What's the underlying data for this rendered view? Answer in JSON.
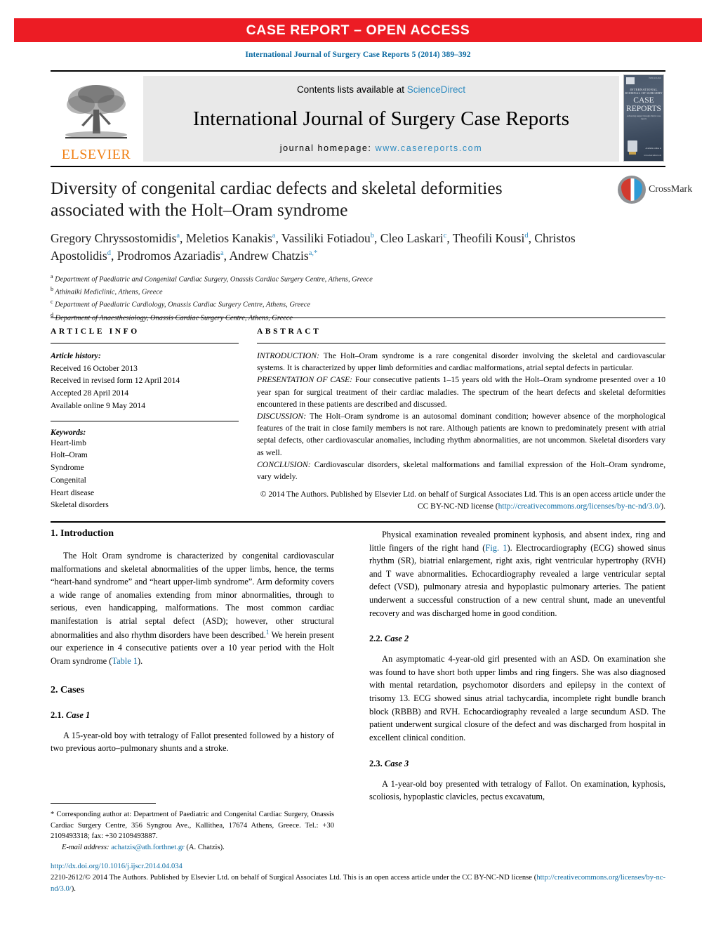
{
  "banner": {
    "text": "CASE REPORT – OPEN ACCESS"
  },
  "citation": {
    "text": "International Journal of Surgery Case Reports 5 (2014) 389–392"
  },
  "masthead": {
    "contents_prefix": "Contents lists available at ",
    "contents_link": "ScienceDirect",
    "journal_title": "International Journal of Surgery Case Reports",
    "homepage_label": "journal homepage: ",
    "homepage_url": "www.casereports.com",
    "publisher": "ELSEVIER",
    "cover": {
      "line1": "INTERNATIONAL",
      "line2": "JOURNAL OF SURGERY",
      "big1": "CASE",
      "big2": "REPORTS",
      "subtitle": "Advancing surgery through clinical case reports",
      "issn": "ISSN 2210-2612",
      "right_text": "Available online at",
      "url": "www.sciencedirect.com"
    }
  },
  "article": {
    "title": "Diversity of congenital cardiac defects and skeletal deformities associated with the Holt–Oram syndrome",
    "authors": [
      {
        "name": "Gregory Chryssostomidis",
        "marks": "a",
        "sep": ", "
      },
      {
        "name": "Meletios Kanakis",
        "marks": "a",
        "sep": ", "
      },
      {
        "name": "Vassiliki Fotiadou",
        "marks": "b",
        "sep": ", "
      },
      {
        "name": "Cleo Laskari",
        "marks": "c",
        "sep": ", "
      },
      {
        "name": "Theofili Kousi",
        "marks": "d",
        "sep": ", "
      },
      {
        "name": "Christos Apostolidis",
        "marks": "d",
        "sep": ", "
      },
      {
        "name": "Prodromos Azariadis",
        "marks": "a",
        "sep": ", "
      },
      {
        "name": "Andrew Chatzis",
        "marks": "a,*",
        "sep": ""
      }
    ],
    "affiliations": [
      {
        "mark": "a",
        "text": "Department of Paediatric and Congenital Cardiac Surgery, Onassis Cardiac Surgery Centre, Athens, Greece"
      },
      {
        "mark": "b",
        "text": "Athinaiki Mediclinic, Athens, Greece"
      },
      {
        "mark": "c",
        "text": "Department of Paediatric Cardiology, Onassis Cardiac Surgery Centre, Athens, Greece"
      },
      {
        "mark": "d",
        "text": "Department of Anaesthesiology, Onassis Cardiac Surgery Centre, Athens, Greece"
      }
    ]
  },
  "crossmark": {
    "label": "CrossMark"
  },
  "article_info": {
    "heading": "ARTICLE INFO",
    "history_label": "Article history:",
    "history": [
      "Received 16 October 2013",
      "Received in revised form 12 April 2014",
      "Accepted 28 April 2014",
      "Available online 9 May 2014"
    ],
    "keywords_label": "Keywords:",
    "keywords": [
      "Heart-limb",
      "Holt–Oram",
      "Syndrome",
      "Congenital",
      "Heart disease",
      "Skeletal disorders"
    ]
  },
  "abstract": {
    "heading": "ABSTRACT",
    "sections": [
      {
        "label": "INTRODUCTION:",
        "text": " The Holt–Oram syndrome is a rare congenital disorder involving the skeletal and cardiovascular systems. It is characterized by upper limb deformities and cardiac malformations, atrial septal defects in particular."
      },
      {
        "label": "PRESENTATION OF CASE:",
        "text": " Four consecutive patients 1–15 years old with the Holt–Oram syndrome presented over a 10 year span for surgical treatment of their cardiac maladies. The spectrum of the heart defects and skeletal deformities encountered in these patients are described and discussed."
      },
      {
        "label": "DISCUSSION:",
        "text": " The Holt–Oram syndrome is an autosomal dominant condition; however absence of the morphological features of the trait in close family members is not rare. Although patients are known to predominately present with atrial septal defects, other cardiovascular anomalies, including rhythm abnormalities, are not uncommon. Skeletal disorders vary as well."
      },
      {
        "label": "CONCLUSION:",
        "text": " Cardiovascular disorders, skeletal malformations and familial expression of the Holt–Oram syndrome, vary widely."
      }
    ],
    "copyright_pre": "© 2014 The Authors. Published by Elsevier Ltd. on behalf of Surgical Associates Ltd. This is an open access article under the CC BY-NC-ND license (",
    "copyright_link": "http://creativecommons.org/licenses/by-nc-nd/3.0/",
    "copyright_post": ")."
  },
  "body": {
    "left": {
      "h_intro": "1. Introduction",
      "p_intro_a": "The Holt Oram syndrome is characterized by congenital cardiovascular malformations and skeletal abnormalities of the upper limbs, hence, the terms “heart-hand syndrome” and “heart upper-limb syndrome”. Arm deformity covers a wide range of anomalies extending from minor abnormalities, through to serious, even handicapping, malformations. The most common cardiac manifestation is atrial septal defect (ASD); however, other structural abnormalities and also rhythm disorders have been described.",
      "p_intro_ref": "1",
      "p_intro_b": " We herein present our experience in 4 consecutive patients over a 10 year period with the Holt Oram syndrome (",
      "p_intro_link": "Table 1",
      "p_intro_c": ").",
      "h_cases": "2. Cases",
      "h_case1_num": "2.1.",
      "h_case1": " Case 1",
      "p_case1": "A 15-year-old boy with tetralogy of Fallot presented followed by a history of two previous aorto–pulmonary shunts and a stroke."
    },
    "right": {
      "p_case1_cont_a": "Physical examination revealed prominent kyphosis, and absent index, ring and little fingers of the right hand (",
      "p_case1_link": "Fig. 1",
      "p_case1_cont_b": "). Electrocardiography (ECG) showed sinus rhythm (SR), biatrial enlargement, right axis, right ventricular hypertrophy (RVH) and T wave abnormalities. Echocardiography revealed a large ventricular septal defect (VSD), pulmonary atresia and hypoplastic pulmonary arteries. The patient underwent a successful construction of a new central shunt, made an uneventful recovery and was discharged home in good condition.",
      "h_case2_num": "2.2.",
      "h_case2": " Case 2",
      "p_case2": "An asymptomatic 4-year-old girl presented with an ASD. On examination she was found to have short both upper limbs and ring fingers. She was also diagnosed with mental retardation, psychomotor disorders and epilepsy in the context of trisomy 13. ECG showed sinus atrial tachycardia, incomplete right bundle branch block (RBBB) and RVH. Echocardiography revealed a large secundum ASD. The patient underwent surgical closure of the defect and was discharged from hospital in excellent clinical condition.",
      "h_case3_num": "2.3.",
      "h_case3": " Case 3",
      "p_case3": "A 1-year-old boy presented with tetralogy of Fallot. On examination, kyphosis, scoliosis, hypoplastic clavicles, pectus excavatum,"
    }
  },
  "footnote": {
    "star": "*",
    "text": " Corresponding author at: Department of Paediatric and Congenital Cardiac Surgery, Onassis Cardiac Surgery Centre, 356 Syngrou Ave., Kallithea, 17674 Athens, Greece. Tel.: +30 2109493318; fax: +30 2109493887.",
    "email_label": "E-mail address:",
    "email": "achatzis@ath.forthnet.gr",
    "email_suffix": " (A. Chatzis)."
  },
  "bottom": {
    "doi": "http://dx.doi.org/10.1016/j.ijscr.2014.04.034",
    "issn_pre": "2210-2612/© 2014 The Authors. Published by Elsevier Ltd. on behalf of Surgical Associates Ltd. This is an open access article under the CC BY-NC-ND license (",
    "license_link": "http://creativecommons.org/licenses/by-nc-nd/3.0/",
    "issn_post": ")."
  },
  "colors": {
    "banner_red": "#ec1c24",
    "link_blue": "#0b6aa2",
    "elsevier_orange": "#f07f13",
    "sciencedirect_blue": "#2f8bc0"
  }
}
